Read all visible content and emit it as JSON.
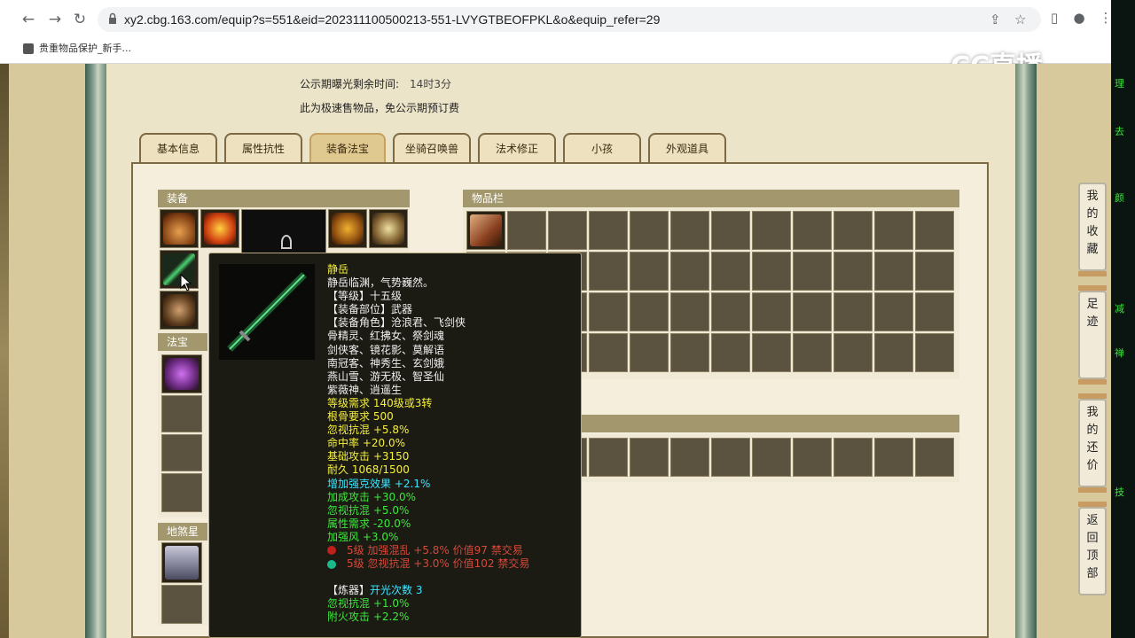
{
  "browser": {
    "url": "xy2.cbg.163.com/equip?s=551&eid=202311100500213-551-LVYGTBEOFPKL&o&equip_refer=29",
    "bookmark_label": "贵重物品保护_新手..."
  },
  "watermark": "CC直播",
  "notice": {
    "public_time_label": "公示期曝光剩余时间:",
    "public_time_value": "14时3分",
    "fast_sale_text": "此为极速售物品，免公示期预订费"
  },
  "tabs": [
    {
      "label": "基本信息",
      "active": false
    },
    {
      "label": "属性抗性",
      "active": false
    },
    {
      "label": "装备法宝",
      "active": true
    },
    {
      "label": "坐骑召唤兽",
      "active": false
    },
    {
      "label": "法术修正",
      "active": false
    },
    {
      "label": "小孩",
      "active": false
    },
    {
      "label": "外观道具",
      "active": false
    }
  ],
  "sections": {
    "equipment": "装备",
    "fabao": "法宝",
    "dishaxing": "地煞星",
    "inventory": "物品栏"
  },
  "tooltip": {
    "name": "静岳",
    "desc": "静岳临渊，气势巍然。",
    "lines": [
      {
        "text": "【等级】十五级",
        "color": "white"
      },
      {
        "text": "【装备部位】武器",
        "color": "white"
      },
      {
        "text": "【装备角色】沧浪君、飞剑侠",
        "color": "white"
      },
      {
        "text": "骨精灵、红拂女、祭剑魂",
        "color": "white"
      },
      {
        "text": "剑侠客、镜花影、莫解语",
        "color": "white"
      },
      {
        "text": "南冠客、神秀生、玄剑娥",
        "color": "white"
      },
      {
        "text": "燕山雪、游无极、智圣仙",
        "color": "white"
      },
      {
        "text": "紫薇神、逍遥生",
        "color": "white"
      },
      {
        "text": "等级需求 140级或3转",
        "color": "yellow"
      },
      {
        "text": "根骨要求 500",
        "color": "yellow"
      },
      {
        "text": "忽视抗混 +5.8%",
        "color": "yellow"
      },
      {
        "text": "命中率 +20.0%",
        "color": "yellow"
      },
      {
        "text": "基础攻击 +3150",
        "color": "yellow"
      },
      {
        "text": "耐久 1068/1500",
        "color": "yellow"
      },
      {
        "text": "增加强克效果 +2.1%",
        "color": "cyan"
      },
      {
        "text": "加成攻击 +30.0%",
        "color": "green"
      },
      {
        "text": "忽视抗混 +5.0%",
        "color": "green"
      },
      {
        "text": "属性需求 -20.0%",
        "color": "green"
      },
      {
        "text": "加强风 +3.0%",
        "color": "green"
      }
    ],
    "gems": [
      {
        "text": "5级 加强混乱 +5.8% 价值97 禁交易",
        "gem_color": "#c0201a"
      },
      {
        "text": "5级 忽视抗混 +3.0% 价值102 禁交易",
        "gem_color": "#1ab98a"
      }
    ],
    "refine_label": "【炼器】",
    "refine_value": "开光次数 3",
    "refine_lines": [
      {
        "text": "忽视抗混 +1.0%",
        "color": "green"
      },
      {
        "text": "附火攻击 +2.2%",
        "color": "green"
      }
    ]
  },
  "side_buttons": [
    "我的收藏",
    "足迹",
    "我的还价",
    "返回顶部"
  ]
}
